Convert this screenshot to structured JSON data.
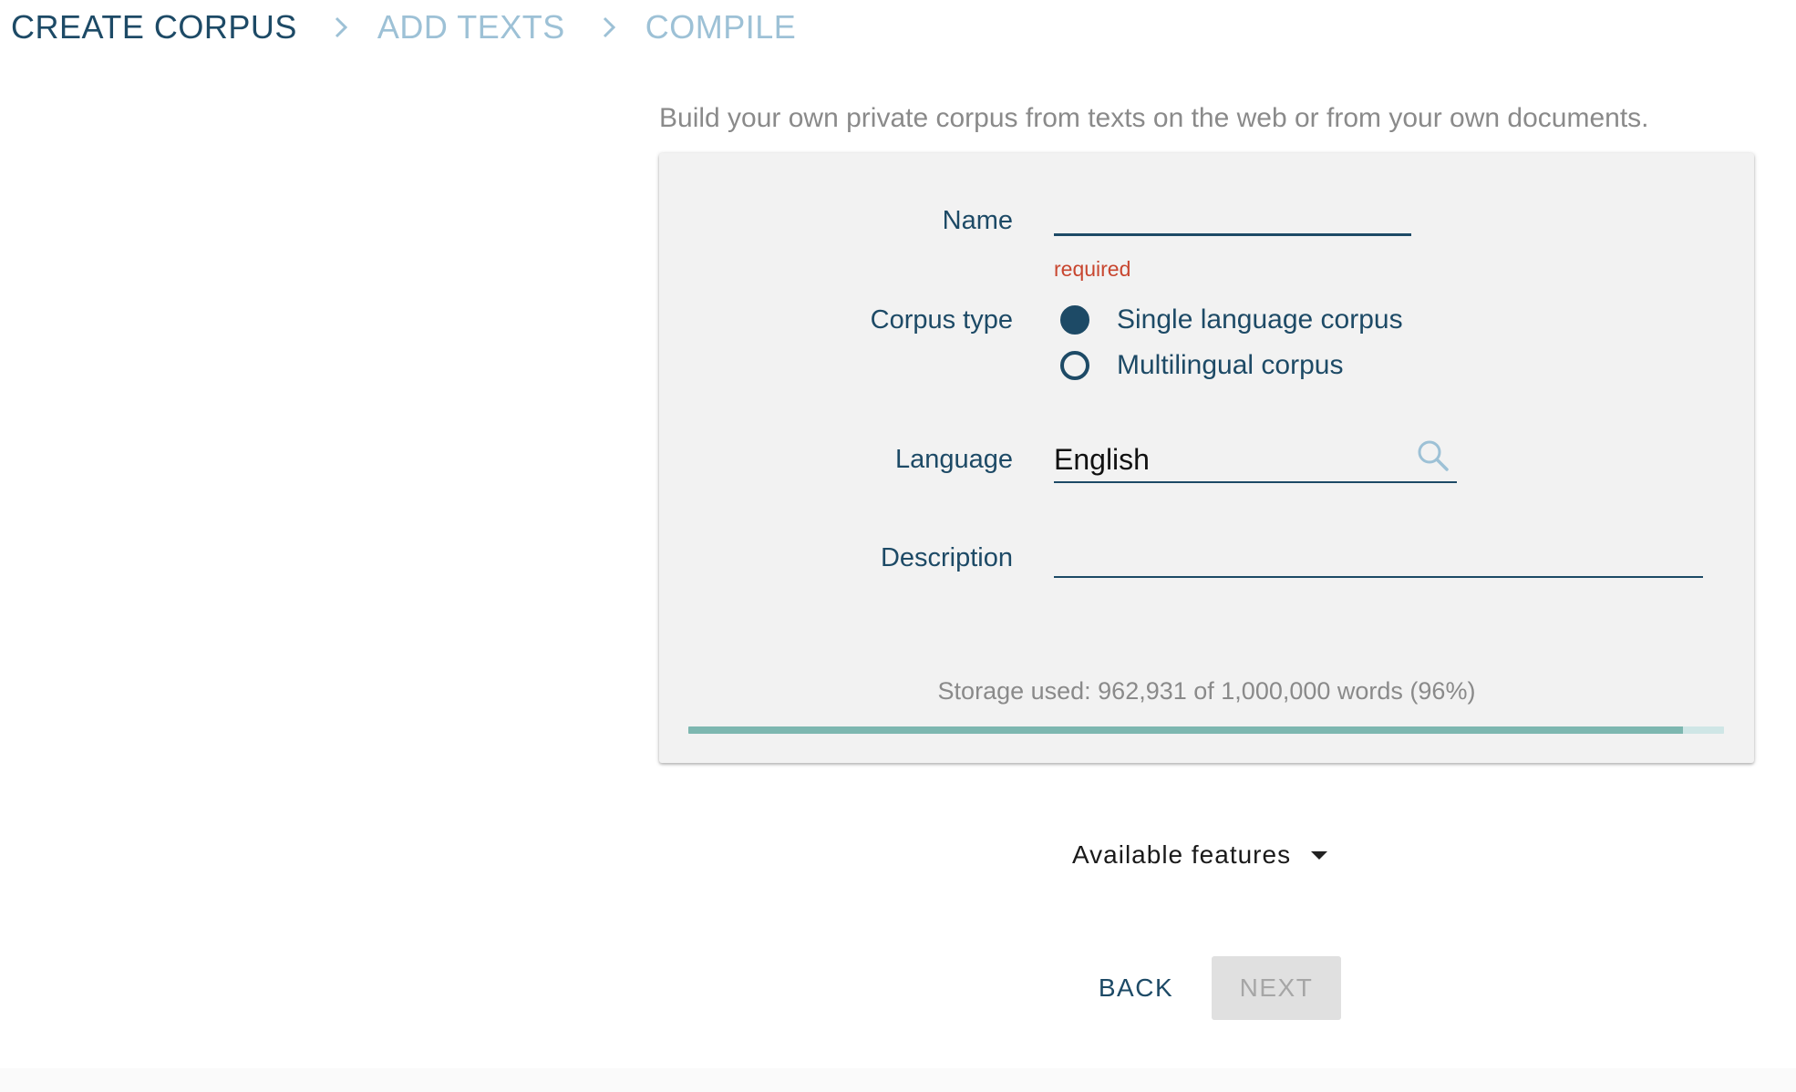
{
  "stepper": {
    "steps": [
      {
        "label": "CREATE CORPUS",
        "state": "active"
      },
      {
        "label": "ADD TEXTS",
        "state": "inactive"
      },
      {
        "label": "COMPILE",
        "state": "inactive"
      }
    ],
    "separator_icon": "chevron-right-icon"
  },
  "subtitle": "Build your own private corpus from texts on the web or from your own documents.",
  "form": {
    "name": {
      "label": "Name",
      "value": "",
      "hint": "required"
    },
    "corpus_type": {
      "label": "Corpus type",
      "options": [
        {
          "label": "Single language corpus",
          "checked": true
        },
        {
          "label": "Multilingual corpus",
          "checked": false
        }
      ]
    },
    "language": {
      "label": "Language",
      "value": "English",
      "icon": "search-icon"
    },
    "description": {
      "label": "Description",
      "value": ""
    }
  },
  "storage": {
    "text": "Storage used: 962,931 of 1,000,000 words (96%)",
    "fraction": 0.96
  },
  "features": {
    "label": "Available features",
    "icon": "caret-down-icon"
  },
  "actions": {
    "back_label": "BACK",
    "next_label": "NEXT",
    "next_disabled": true
  },
  "colors": {
    "primary": "#1d4a66",
    "inactive_step": "#9dc1d6",
    "error": "#c8462f",
    "card_bg": "#f2f2f2",
    "progress_fill": "#7db7b0",
    "progress_track": "#cfe6e6"
  }
}
